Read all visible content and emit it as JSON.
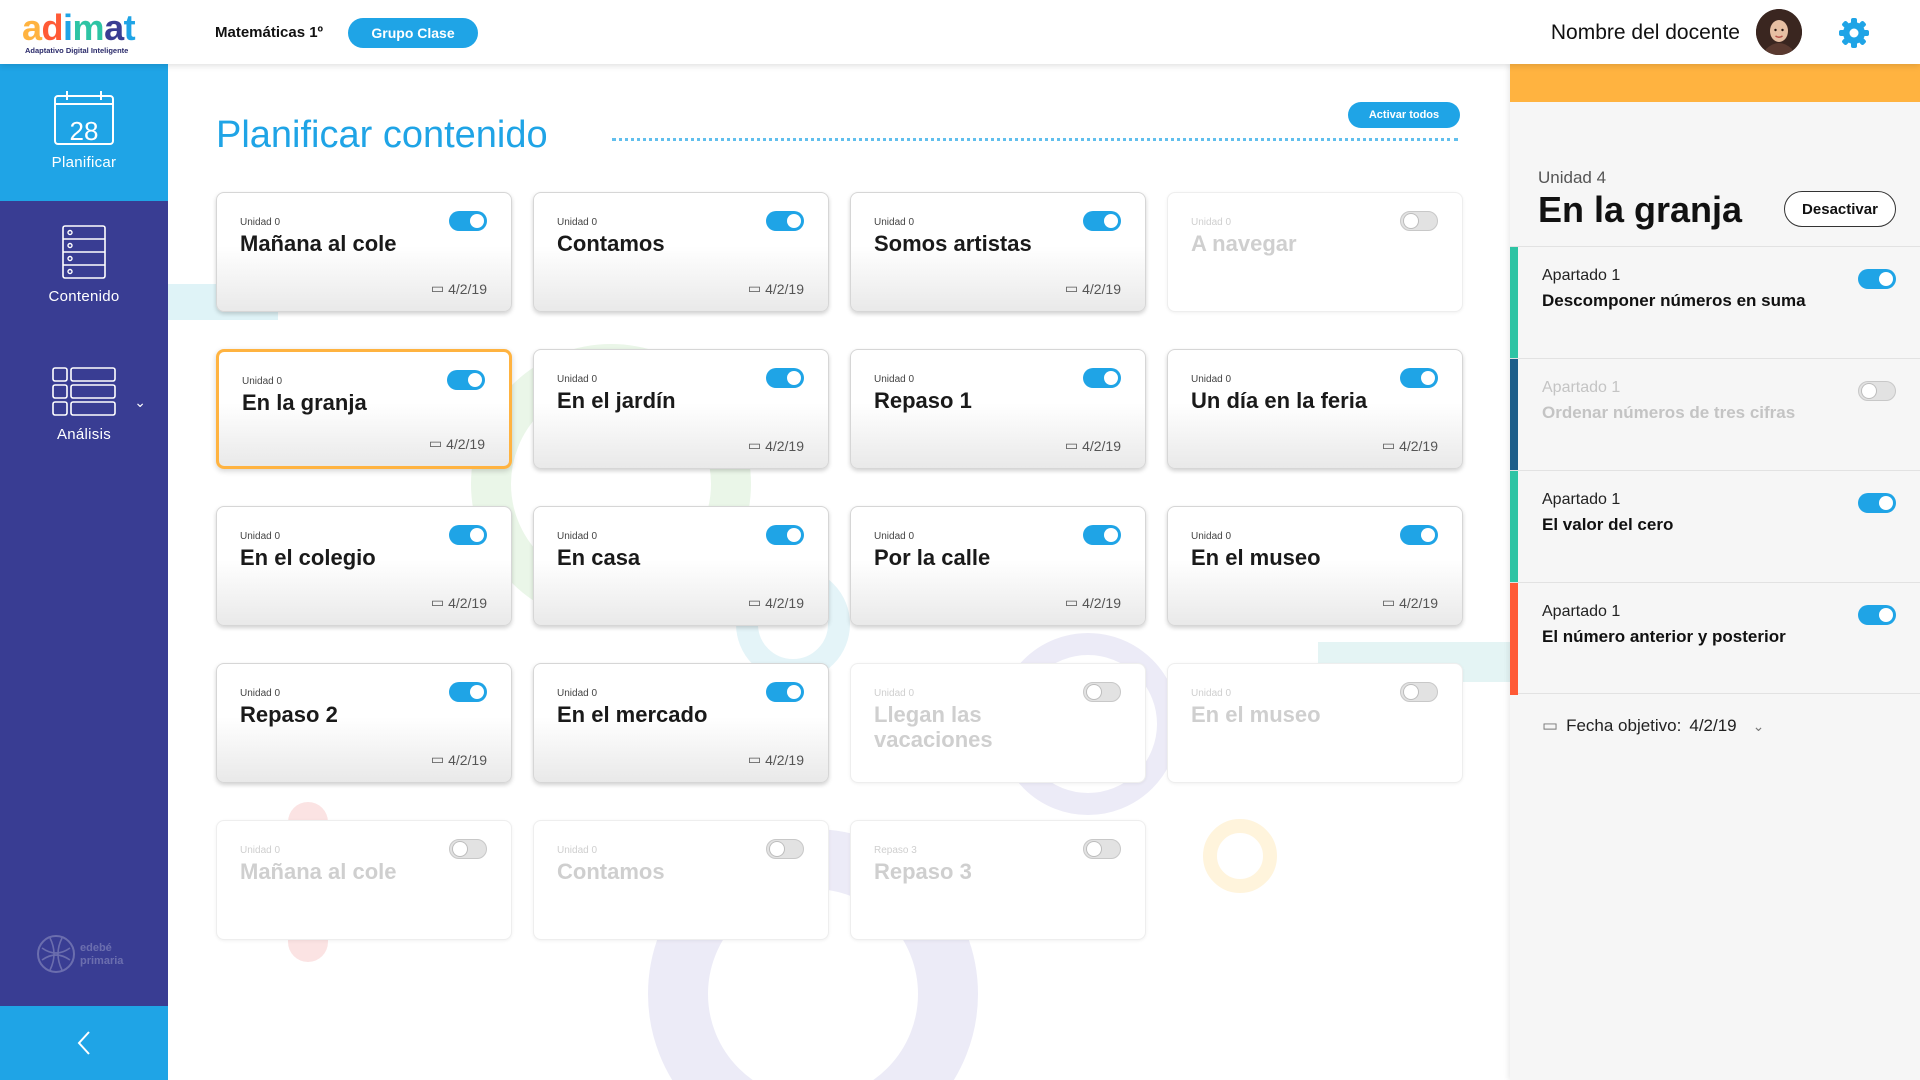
{
  "header": {
    "logo_text": "adimat",
    "logo_subtitle": "Adaptativo Digital Inteligente",
    "subject": "Matemáticas 1º",
    "group_button": "Grupo Clase",
    "teacher_name": "Nombre del docente"
  },
  "sidebar": {
    "items": [
      {
        "label": "Planificar",
        "icon": "calendar-icon",
        "day": "28",
        "active": true
      },
      {
        "label": "Contenido",
        "icon": "cabinet-icon",
        "active": false
      },
      {
        "label": "Análisis",
        "icon": "grid-icon",
        "active": false
      }
    ],
    "brand": "edebé primaria"
  },
  "main": {
    "title": "Planificar contenido",
    "activate_all": "Activar todos",
    "cards": [
      {
        "unit": "Unidad 0",
        "title": "Mañana al cole",
        "date": "4/2/19",
        "enabled": true
      },
      {
        "unit": "Unidad 0",
        "title": "Contamos",
        "date": "4/2/19",
        "enabled": true
      },
      {
        "unit": "Unidad 0",
        "title": "Somos artistas",
        "date": "4/2/19",
        "enabled": true
      },
      {
        "unit": "Unidad 0",
        "title": "A navegar",
        "date": "",
        "enabled": false
      },
      {
        "unit": "Unidad 0",
        "title": "En la granja",
        "date": "4/2/19",
        "enabled": true,
        "selected": true
      },
      {
        "unit": "Unidad 0",
        "title": "En el jardín",
        "date": "4/2/19",
        "enabled": true
      },
      {
        "unit": "Unidad 0",
        "title": "Repaso 1",
        "date": "4/2/19",
        "enabled": true
      },
      {
        "unit": "Unidad 0",
        "title": "Un día en la feria",
        "date": "4/2/19",
        "enabled": true
      },
      {
        "unit": "Unidad 0",
        "title": "En el colegio",
        "date": "4/2/19",
        "enabled": true
      },
      {
        "unit": "Unidad 0",
        "title": "En casa",
        "date": "4/2/19",
        "enabled": true
      },
      {
        "unit": "Unidad 0",
        "title": "Por la calle",
        "date": "4/2/19",
        "enabled": true
      },
      {
        "unit": "Unidad 0",
        "title": "En el museo",
        "date": "4/2/19",
        "enabled": true
      },
      {
        "unit": "Unidad 0",
        "title": "Repaso 2",
        "date": "4/2/19",
        "enabled": true
      },
      {
        "unit": "Unidad 0",
        "title": "En el mercado",
        "date": "4/2/19",
        "enabled": true
      },
      {
        "unit": "Unidad 0",
        "title": "Llegan las vacaciones",
        "date": "",
        "enabled": false
      },
      {
        "unit": "Unidad 0",
        "title": "En el museo",
        "date": "",
        "enabled": false
      },
      {
        "unit": "Unidad 0",
        "title": "Mañana al cole",
        "date": "",
        "enabled": false
      },
      {
        "unit": "Unidad 0",
        "title": "Contamos",
        "date": "",
        "enabled": false
      },
      {
        "unit": "Repaso 3",
        "title": "Repaso 3",
        "date": "",
        "enabled": false
      }
    ]
  },
  "panel": {
    "unit": "Unidad 4",
    "title": "En la granja",
    "deactivate": "Desactivar",
    "apartados": [
      {
        "label": "Apartado 1",
        "name": "Descomponer números en suma",
        "enabled": true,
        "color": "#2ec4a4"
      },
      {
        "label": "Apartado 1",
        "name": "Ordenar números de tres cifras",
        "enabled": false,
        "color": "#1d5e8a"
      },
      {
        "label": "Apartado 1",
        "name": "El valor del cero",
        "enabled": true,
        "color": "#2ec4a4"
      },
      {
        "label": "Apartado 1",
        "name": "El número anterior y posterior",
        "enabled": true,
        "color": "#ff5a36"
      }
    ],
    "target_label": "Fecha objetivo:",
    "target_date": "4/2/19"
  },
  "colors": {
    "accent": "#1fa4e6",
    "sidebar": "#393d93",
    "highlight": "#ffb340"
  }
}
